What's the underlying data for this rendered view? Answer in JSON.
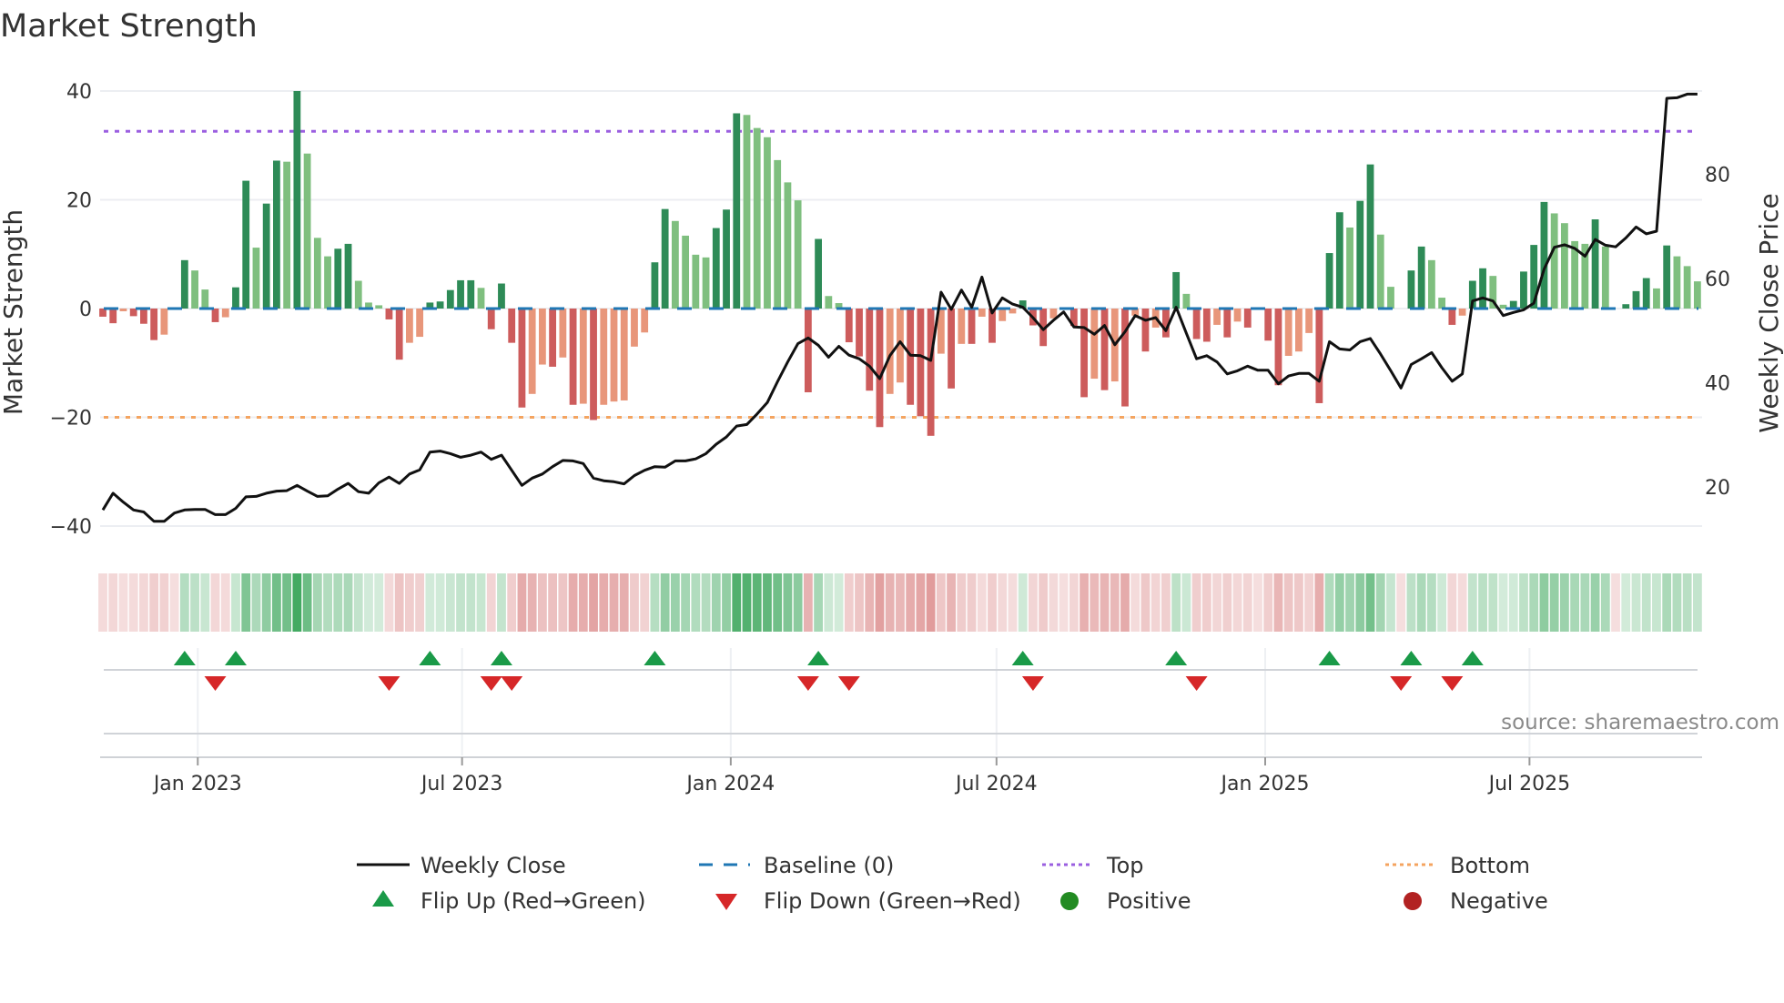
{
  "chart_data": {
    "type": "bar",
    "title": "Market Strength",
    "ylabel": "Market Strength",
    "y2label": "Weekly Close Price",
    "ylim": [
      -40,
      40
    ],
    "y2lim": [
      12.5,
      96
    ],
    "yticks": [
      -40,
      -20,
      0,
      20,
      40
    ],
    "yticks_labels": [
      "−40",
      "−20",
      "0",
      "20",
      "40"
    ],
    "y2ticks": [
      20,
      40,
      60,
      80
    ],
    "y2ticks_labels": [
      "20",
      "40",
      "60",
      "80"
    ],
    "x_start": "2022-10-28",
    "x_step_days": 7,
    "xticks": [
      {
        "date": "2023-01-01",
        "label": "Jan 2023"
      },
      {
        "date": "2023-07-01",
        "label": "Jul 2023"
      },
      {
        "date": "2024-01-01",
        "label": "Jan 2024"
      },
      {
        "date": "2024-07-01",
        "label": "Jul 2024"
      },
      {
        "date": "2025-01-01",
        "label": "Jan 2025"
      },
      {
        "date": "2025-07-01",
        "label": "Jul 2025"
      }
    ],
    "reference_lines": {
      "baseline": 0,
      "top": 32.6,
      "bottom": -20
    },
    "strength": [
      -1.5,
      -2.7,
      -0.5,
      -1.4,
      -2.8,
      -5.8,
      -4.8,
      0,
      8.9,
      7,
      3.5,
      -2.5,
      -1.6,
      3.9,
      23.5,
      11.2,
      19.3,
      27.2,
      27,
      40,
      28.5,
      13,
      9.6,
      11,
      11.9,
      5.1,
      1.1,
      0.6,
      -2,
      -9.4,
      -6.3,
      -5.2,
      1.1,
      1.3,
      3.4,
      5.2,
      5.2,
      3.8,
      -3.8,
      4.6,
      -6.3,
      -18.2,
      -15.7,
      -10.3,
      -10.7,
      -9,
      -17.7,
      -17.5,
      -20.5,
      -17.7,
      -17.1,
      -16.9,
      -7,
      -4.4,
      8.5,
      18.3,
      16.1,
      13.4,
      9.9,
      9.4,
      14.8,
      18.2,
      35.9,
      35.6,
      33.2,
      31.5,
      27.3,
      23.2,
      19.9,
      -15.4,
      12.8,
      2.3,
      1,
      -6.2,
      -8.8,
      -15.1,
      -21.8,
      -15.7,
      -13.6,
      -17.7,
      -19.8,
      -23.4,
      -8.3,
      -14.7,
      -6.5,
      -6.5,
      -1.5,
      -6.3,
      -2.3,
      -0.9,
      1.5,
      -3.1,
      -6.9,
      -1.8,
      0,
      -3.2,
      -16.3,
      -12.9,
      -15,
      -13.4,
      -18,
      -1.3,
      -7.9,
      -3.5,
      -5.3,
      6.7,
      2.7,
      -5.6,
      -6.1,
      -3,
      -5.3,
      -2.4,
      -3.5,
      0,
      -5.9,
      -14.1,
      -8.7,
      -7.9,
      -4.5,
      -17.4,
      10.2,
      17.7,
      14.9,
      19.8,
      26.5,
      13.6,
      4,
      0,
      7,
      11.4,
      8.9,
      2,
      -3,
      -1.3,
      5.1,
      7.4,
      6,
      0.7,
      1.4,
      6.8,
      11.7,
      19.6,
      17.5,
      15.7,
      12.4,
      11.9,
      16.4,
      11.4,
      0,
      0.8,
      3.2,
      5.6,
      3.7,
      11.6,
      9.6,
      7.8,
      5
    ],
    "weekly_close": [
      15.6,
      18.8,
      17.1,
      15.6,
      15.2,
      13.4,
      13.4,
      15.0,
      15.6,
      15.7,
      15.7,
      14.7,
      14.7,
      15.9,
      18.1,
      18.2,
      18.8,
      19.2,
      19.3,
      20.3,
      19.2,
      18.2,
      18.3,
      19.6,
      20.7,
      19.1,
      18.8,
      20.8,
      21.9,
      20.7,
      22.5,
      23.3,
      26.7,
      26.9,
      26.4,
      25.7,
      26.1,
      26.7,
      25.3,
      26.1,
      23.2,
      20.3,
      21.7,
      22.5,
      23.9,
      25.1,
      25.0,
      24.5,
      21.7,
      21.2,
      21.0,
      20.6,
      22.2,
      23.2,
      23.9,
      23.8,
      25.0,
      25.0,
      25.4,
      26.4,
      28.2,
      29.6,
      31.7,
      32.0,
      34.0,
      36.2,
      40.2,
      44.0,
      47.5,
      48.6,
      47.2,
      44.9,
      47.0,
      45.3,
      44.6,
      43.2,
      40.8,
      45.2,
      47.9,
      45.3,
      45.2,
      44.3,
      57.4,
      54.1,
      57.8,
      54.5,
      60.3,
      53.4,
      56.3,
      55.1,
      54.5,
      52.5,
      50.2,
      52.0,
      53.6,
      50.7,
      50.6,
      49.3,
      51.0,
      47.3,
      49.8,
      52.9,
      52.0,
      52.5,
      50.0,
      54.5,
      49.5,
      44.6,
      45.2,
      44.0,
      41.7,
      42.3,
      43.2,
      42.4,
      42.4,
      39.8,
      41.3,
      41.8,
      41.8,
      40.3,
      47.9,
      46.5,
      46.3,
      47.9,
      48.5,
      45.5,
      42.3,
      39.0,
      43.5,
      44.6,
      45.8,
      42.9,
      40.3,
      41.7,
      55.7,
      56.3,
      55.7,
      52.9,
      53.5,
      54.0,
      55.3,
      61.8,
      66.0,
      66.5,
      65.8,
      64.3,
      67.5,
      66.4,
      66.1,
      67.8,
      69.9,
      68.6,
      69.1,
      94.6,
      94.7,
      95.4,
      95.4
    ],
    "flip_up_weeks": [
      8,
      13,
      32,
      39,
      54,
      70,
      90,
      105,
      120,
      128,
      134
    ],
    "flip_down_weeks": [
      11,
      28,
      38,
      40,
      69,
      73,
      91,
      107,
      127,
      132
    ],
    "legend": {
      "placement": "bottom",
      "items": [
        {
          "label": "Weekly Close"
        },
        {
          "label": "Baseline (0)"
        },
        {
          "label": "Top"
        },
        {
          "label": "Bottom"
        },
        {
          "label": "Flip Up (Red→Green)"
        },
        {
          "label": "Flip Down (Green→Red)"
        },
        {
          "label": "Positive"
        },
        {
          "label": "Negative"
        }
      ]
    },
    "source": "source: sharemaestro.com",
    "colors": {
      "pos_rising": "#2e8b57",
      "pos_falling": "#7fbf7f",
      "neg_falling": "#cd5c5c",
      "neg_rising": "#e8967a",
      "price": "#111111",
      "baseline": "#1f77b4",
      "top": "#9b5fe0",
      "bottom": "#f4a460",
      "flip_up": "#1a9a48",
      "flip_down": "#d62728",
      "positive": "#228b22",
      "negative": "#b22222"
    }
  }
}
